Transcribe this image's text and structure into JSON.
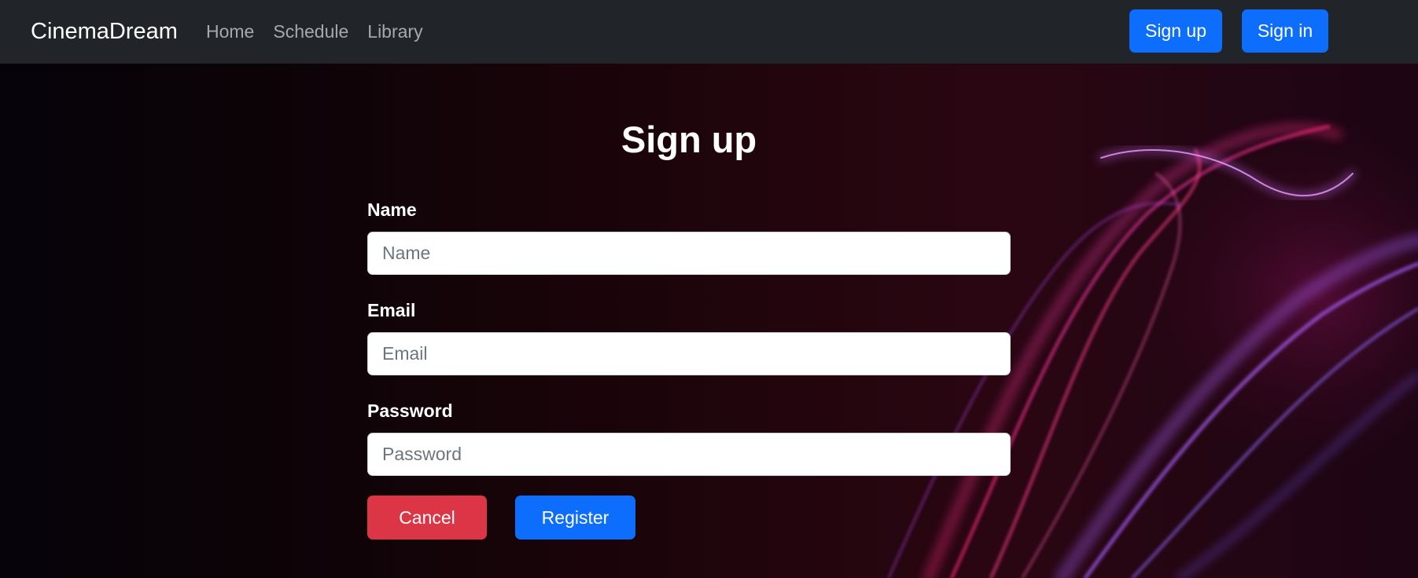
{
  "navbar": {
    "brand": "CinemaDream",
    "links": [
      "Home",
      "Schedule",
      "Library"
    ],
    "signup_label": "Sign up",
    "signin_label": "Sign in"
  },
  "form": {
    "title": "Sign up",
    "name_label": "Name",
    "name_placeholder": "Name",
    "name_value": "",
    "email_label": "Email",
    "email_placeholder": "Email",
    "email_value": "",
    "password_label": "Password",
    "password_placeholder": "Password",
    "password_value": "",
    "cancel_label": "Cancel",
    "register_label": "Register"
  },
  "colors": {
    "navbar_bg": "#212529",
    "primary": "#0d6efd",
    "danger": "#dc3545",
    "accent_purple": "#b040ff",
    "accent_pink": "#ff2a7a"
  },
  "icons": [
    "background-light-swirl"
  ]
}
